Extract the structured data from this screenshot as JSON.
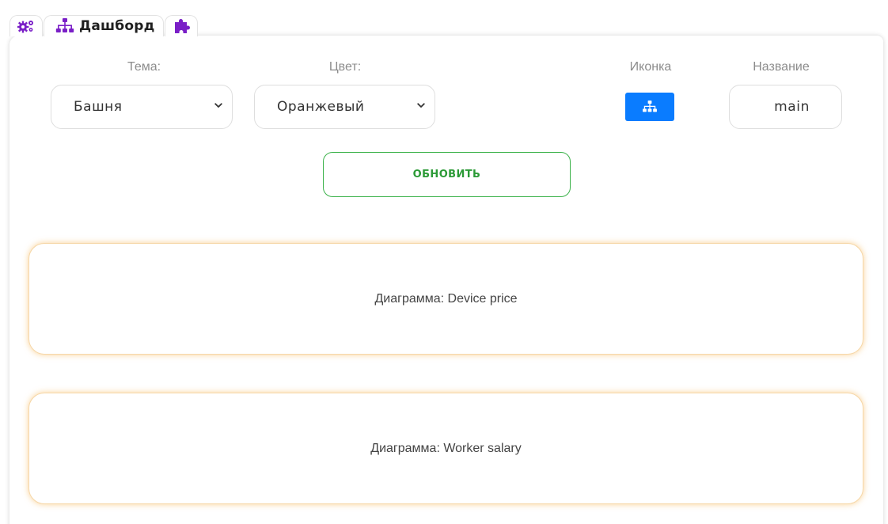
{
  "tabs": [
    {
      "id": "settings",
      "icon": "gears-icon",
      "label": ""
    },
    {
      "id": "dashboard",
      "icon": "sitemap-icon",
      "label": "Дашборд"
    },
    {
      "id": "plugins",
      "icon": "puzzle-icon",
      "label": ""
    }
  ],
  "form": {
    "theme": {
      "label": "Тема:",
      "value": "Башня"
    },
    "color": {
      "label": "Цвет:",
      "value": "Оранжевый"
    },
    "icon": {
      "label": "Иконка",
      "value_icon": "sitemap-icon"
    },
    "name": {
      "label": "Название",
      "value": "main"
    },
    "update_label": "ОБНОВИТЬ"
  },
  "charts": [
    {
      "label": "Диаграмма: Device price"
    },
    {
      "label": "Диаграмма: Worker salary"
    }
  ],
  "colors": {
    "tab_icon": "#7a1fc7",
    "icon_button": "#0a7cff",
    "update_button": "#2b9a36",
    "chart_glow": "#f5ab3c",
    "label_gray": "#8c8c8c"
  }
}
